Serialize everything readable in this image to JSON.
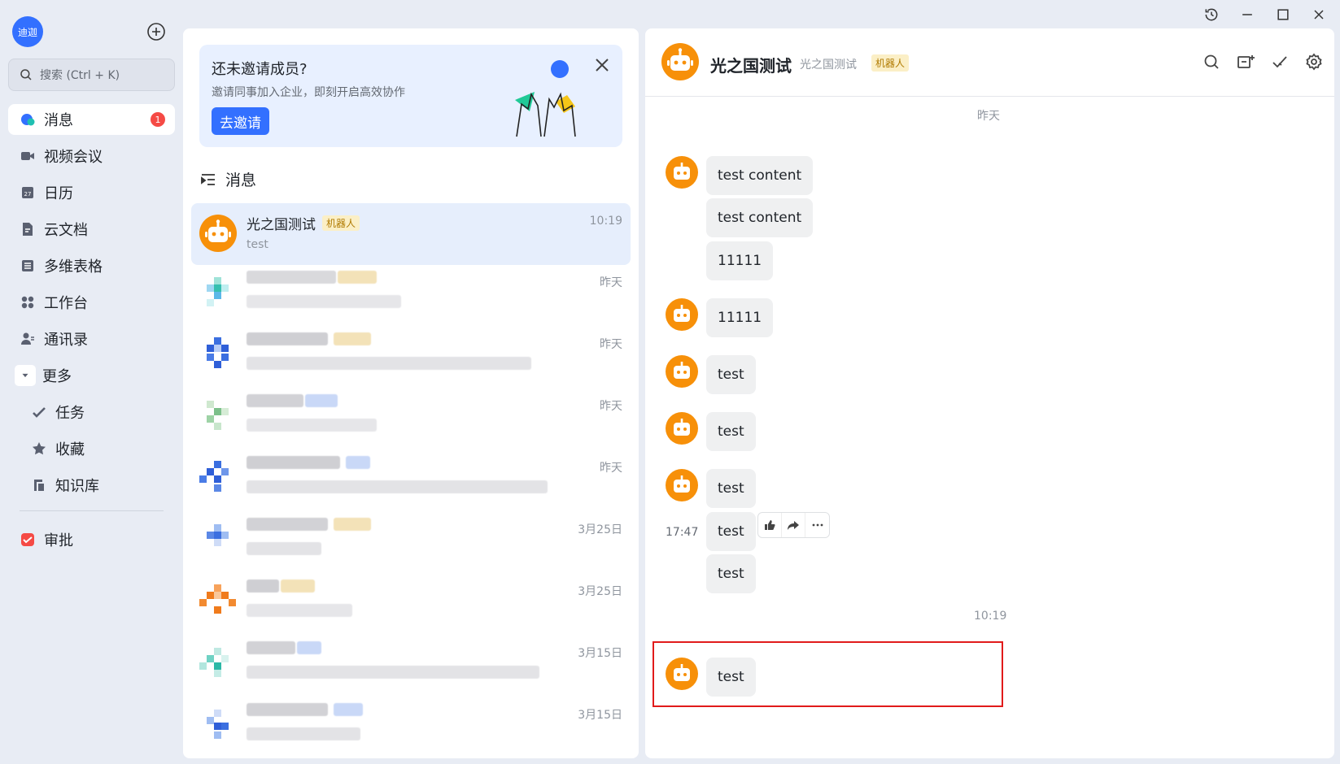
{
  "window": {
    "controls": [
      "history-icon",
      "minimize-icon",
      "maximize-icon",
      "close-icon"
    ]
  },
  "user": {
    "avatar_text": "迪迦"
  },
  "search": {
    "placeholder": "搜索 (Ctrl + K)"
  },
  "nav": {
    "items": [
      {
        "label": "消息",
        "icon": "message-icon",
        "badge": "1",
        "active": true
      },
      {
        "label": "视频会议",
        "icon": "video-icon"
      },
      {
        "label": "日历",
        "icon": "calendar-icon"
      },
      {
        "label": "云文档",
        "icon": "doc-icon"
      },
      {
        "label": "多维表格",
        "icon": "table-icon"
      },
      {
        "label": "工作台",
        "icon": "workbench-icon"
      },
      {
        "label": "通讯录",
        "icon": "contacts-icon"
      },
      {
        "label": "更多",
        "icon": "collapse-icon"
      }
    ],
    "sub_items": [
      {
        "label": "任务",
        "icon": "task-icon"
      },
      {
        "label": "收藏",
        "icon": "star-icon"
      },
      {
        "label": "知识库",
        "icon": "wiki-icon"
      }
    ],
    "apps": [
      {
        "label": "审批",
        "icon": "approval-icon"
      }
    ],
    "calendar_day": "27"
  },
  "invite": {
    "title": "还未邀请成员?",
    "subtitle": "邀请同事加入企业，即刻开启高效协作",
    "button": "去邀请"
  },
  "section": {
    "title": "消息"
  },
  "conversations": [
    {
      "name": "光之国测试",
      "tag": "机器人",
      "preview": "test",
      "time": "10:19",
      "active": true
    },
    {
      "time": "昨天"
    },
    {
      "time": "昨天"
    },
    {
      "time": "昨天"
    },
    {
      "time": "昨天"
    },
    {
      "time": "3月25日"
    },
    {
      "time": "3月25日"
    },
    {
      "time": "3月15日"
    },
    {
      "time": "3月15日"
    }
  ],
  "chat": {
    "title": "光之国测试",
    "subtitle": "光之国测试",
    "tag": "机器人",
    "tools": [
      "search-icon",
      "add-chat-icon",
      "check-icon",
      "settings-icon"
    ],
    "dividers": [
      "昨天",
      "10:19"
    ],
    "messages": [
      {
        "text": "test content"
      },
      {
        "text": "test content"
      },
      {
        "text": "11111"
      },
      {
        "text": "11111"
      },
      {
        "text": "test"
      },
      {
        "text": "test"
      },
      {
        "text": "test"
      },
      {
        "text": "test",
        "time": "17:47"
      },
      {
        "text": "test"
      },
      {
        "text": "test"
      }
    ]
  },
  "colors": {
    "accent": "#3370ff",
    "robot_orange": "#f79009",
    "badge_red": "#f54a45",
    "highlight_red": "#e11b1b"
  }
}
